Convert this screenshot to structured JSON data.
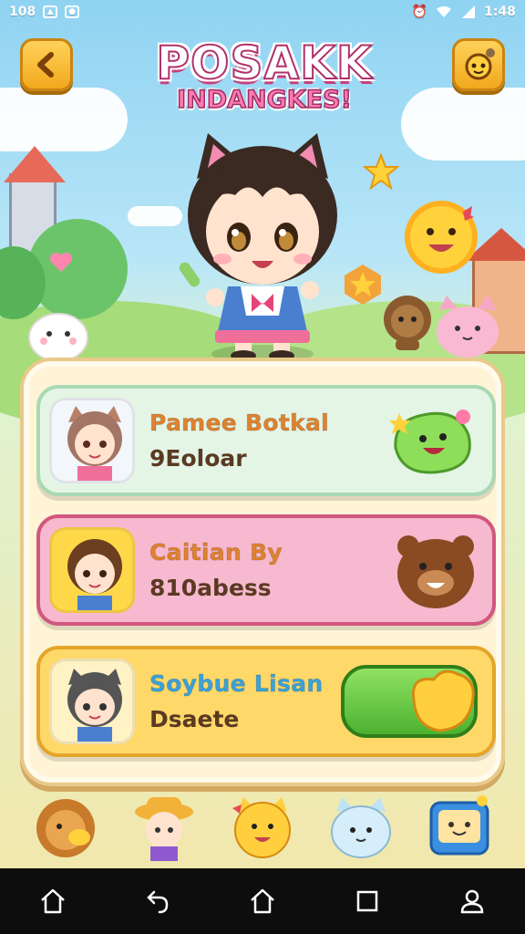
{
  "status_bar": {
    "left_text": "108",
    "icons": [
      "gallery-icon",
      "notification-icon"
    ],
    "right_icons": [
      "alarm-icon",
      "wifi-icon",
      "signal-icon"
    ],
    "time": "1:48"
  },
  "header": {
    "back_icon": "chevron-left-icon",
    "settings_icon": "gear-creature-icon",
    "title": "POSAKK",
    "subtitle": "INDANGKES!"
  },
  "cards": [
    {
      "name": "Pamee Botkal",
      "subtitle": "9Eoloar",
      "name_color": "#e0822e",
      "bg": "#e4f5e6",
      "border": "#a9d8b4",
      "badge": "green-slime-icon"
    },
    {
      "name": "Caitian By",
      "subtitle": "810abess",
      "name_color": "#e0822e",
      "bg": "#f7b9cf",
      "border": "#d1577e",
      "badge": "bear-face-icon"
    },
    {
      "name": "Soybue Lisan",
      "subtitle": "Dsaete",
      "name_color": "#3aa3d9",
      "bg": "#ffd86a",
      "border": "#e5a52a",
      "badge": "green-toggle-button"
    }
  ],
  "bottom_characters": [
    "lion-pet-icon",
    "hat-girl-icon",
    "yellow-cat-icon",
    "blue-cat-icon",
    "tv-robot-icon"
  ],
  "nav": [
    "home-icon",
    "back-icon",
    "home-outline-icon",
    "recents-icon",
    "person-icon"
  ]
}
